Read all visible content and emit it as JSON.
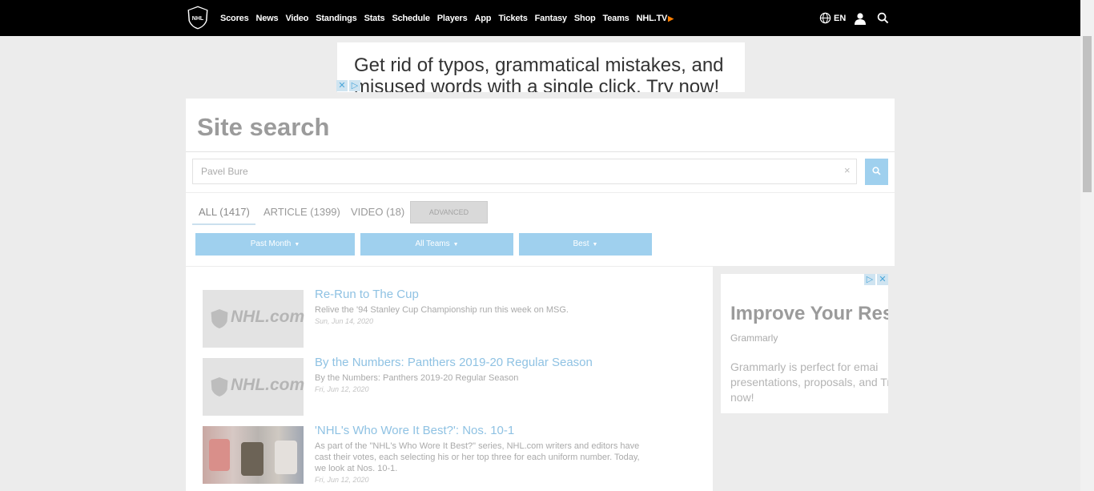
{
  "nav": {
    "links": [
      "Scores",
      "News",
      "Video",
      "Standings",
      "Stats",
      "Schedule",
      "Players",
      "App",
      "Tickets",
      "Fantasy",
      "Shop",
      "Teams",
      "NHL.TV"
    ],
    "language": "EN"
  },
  "top_ad": {
    "line1": "Get rid of typos, grammatical mistakes, and",
    "line2": "misused words with a single click. Try now!"
  },
  "search": {
    "title": "Site search",
    "query": "Pavel Bure",
    "clear": "×",
    "tabs": {
      "all": "ALL (1417)",
      "article": "ARTICLE (1399)",
      "video": "VIDEO (18)",
      "advanced": "ADVANCED"
    },
    "filters": {
      "time": "Past Month",
      "teams": "All Teams",
      "sort": "Best"
    }
  },
  "results": [
    {
      "thumb": "NHL.com",
      "title": "Re-Run to The Cup",
      "desc": "Relive the '94 Stanley Cup Championship run this week on MSG.",
      "date": "Sun, Jun 14, 2020"
    },
    {
      "thumb": "NHL.com",
      "title": "By the Numbers: Panthers 2019-20 Regular Season",
      "desc": "By the Numbers: Panthers 2019-20 Regular Season",
      "date": "Fri, Jun 12, 2020"
    },
    {
      "title": "'NHL's Who Wore It Best?': Nos. 10-1",
      "desc": "As part of the \"NHL's Who Wore It Best?\" series, NHL.com writers and editors have cast their votes, each selecting his or her top three for each uniform number. Today, we look at Nos. 10-1.",
      "date": "Fri, Jun 12, 2020"
    }
  ],
  "side_ad": {
    "title": "Improve Your Res",
    "brand": "Grammarly",
    "body": "Grammarly is perfect for emai presentations, proposals, and Try now!"
  },
  "colors": {
    "nav_bg": "#000000",
    "accent_blue": "#9fd0ee",
    "nhltv_orange": "#ff7f00"
  }
}
